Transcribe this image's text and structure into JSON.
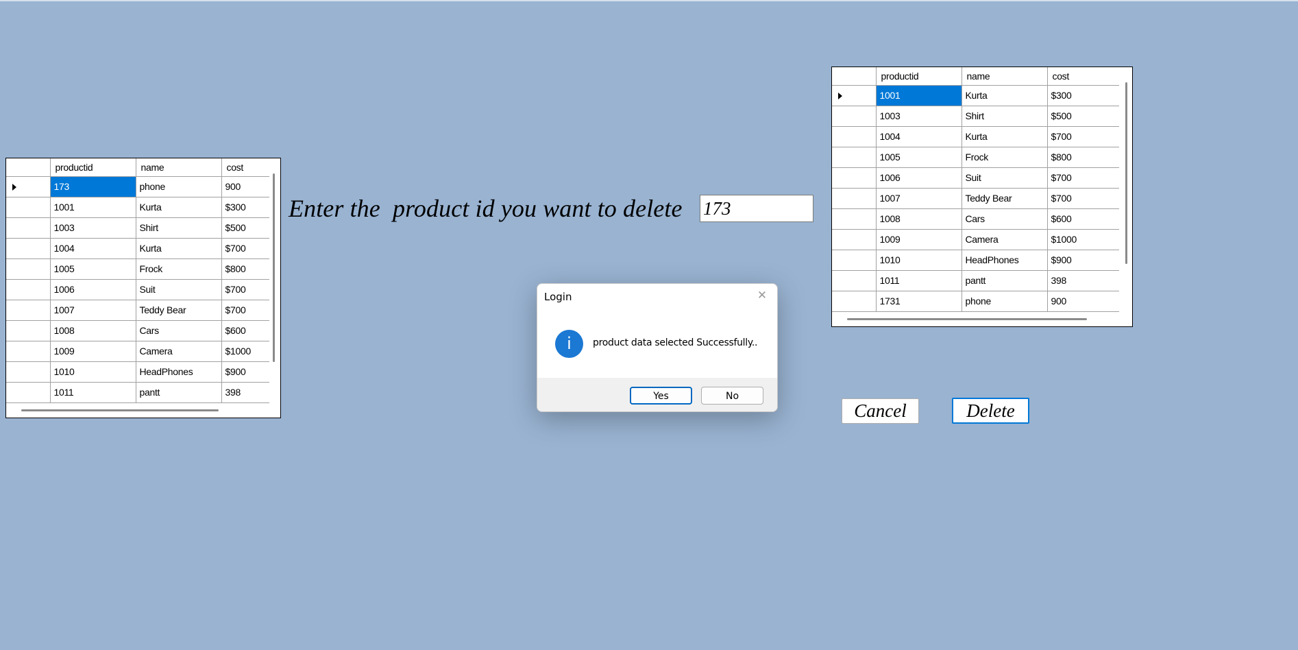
{
  "prompt": {
    "label": "Enter the  product id you want to delete",
    "input_value": "173"
  },
  "buttons": {
    "cancel": "Cancel",
    "delete": "Delete"
  },
  "left_grid": {
    "columns": [
      "productid",
      "name",
      "cost"
    ],
    "rows": [
      [
        "173",
        "phone",
        "900"
      ],
      [
        "1001",
        "Kurta",
        "$300"
      ],
      [
        "1003",
        "Shirt",
        "$500"
      ],
      [
        "1004",
        "Kurta",
        "$700"
      ],
      [
        "1005",
        "Frock",
        "$800"
      ],
      [
        "1006",
        "Suit",
        "$700"
      ],
      [
        "1007",
        "Teddy Bear",
        "$700"
      ],
      [
        "1008",
        "Cars",
        "$600"
      ],
      [
        "1009",
        "Camera",
        "$1000"
      ],
      [
        "1010",
        "HeadPhones",
        "$900"
      ],
      [
        "1011",
        "pantt",
        "398"
      ]
    ]
  },
  "right_grid": {
    "columns": [
      "productid",
      "name",
      "cost"
    ],
    "rows": [
      [
        "1001",
        "Kurta",
        "$300"
      ],
      [
        "1003",
        "Shirt",
        "$500"
      ],
      [
        "1004",
        "Kurta",
        "$700"
      ],
      [
        "1005",
        "Frock",
        "$800"
      ],
      [
        "1006",
        "Suit",
        "$700"
      ],
      [
        "1007",
        "Teddy Bear",
        "$700"
      ],
      [
        "1008",
        "Cars",
        "$600"
      ],
      [
        "1009",
        "Camera",
        "$1000"
      ],
      [
        "1010",
        "HeadPhones",
        "$900"
      ],
      [
        "1011",
        "pantt",
        "398"
      ],
      [
        "1731",
        "phone",
        "900"
      ]
    ]
  },
  "dialog": {
    "title": "Login",
    "message": "product data selected Successfully..",
    "icon": "info-icon",
    "yes": "Yes",
    "no": "No"
  },
  "colors": {
    "background": "#99b3d1",
    "selection": "#0078d7",
    "info_icon": "#1b78d3"
  }
}
